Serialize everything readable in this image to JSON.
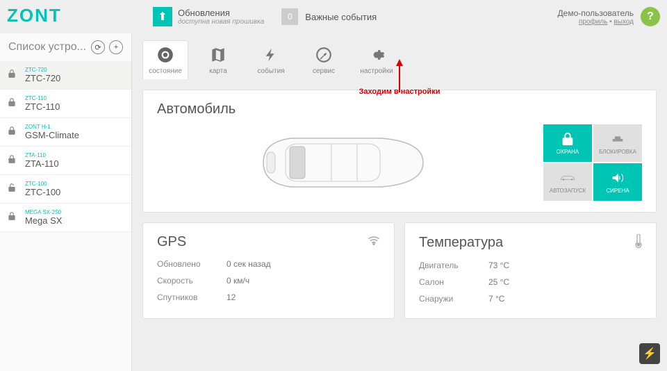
{
  "header": {
    "logo": "ZONT",
    "update_title": "Обновления",
    "update_sub": "доступна новая прошивка",
    "events_count": "0",
    "events_label": "Важные события",
    "user_name": "Демо-пользователь",
    "profile_link": "профиль",
    "logout_link": "выход"
  },
  "sidebar": {
    "title": "Список устро...",
    "devices": [
      {
        "model": "ZTC-720",
        "name": "ZTC-720",
        "locked": true
      },
      {
        "model": "ZTC-110",
        "name": "ZTC-110",
        "locked": true
      },
      {
        "model": "ZONT H-1",
        "name": "GSM-Climate",
        "locked": true
      },
      {
        "model": "ZTA-110",
        "name": "ZTA-110",
        "locked": true
      },
      {
        "model": "ZTC-100",
        "name": "ZTC-100",
        "locked": false
      },
      {
        "model": "MEGA SX-250",
        "name": "Mega SX",
        "locked": true
      }
    ]
  },
  "tabs": {
    "state": "состояние",
    "map": "карта",
    "events": "события",
    "service": "сервис",
    "settings": "настройки"
  },
  "auto_panel": {
    "title": "Автомобиль",
    "note": "Заходим в настройки",
    "controls": {
      "guard": "ОХРАНА",
      "block": "БЛОКИРОВКА",
      "autostart": "АВТОЗАПУСК",
      "siren": "СИРЕНА"
    }
  },
  "gps_panel": {
    "title": "GPS",
    "rows": [
      {
        "k": "Обновлено",
        "v": "0 сек назад"
      },
      {
        "k": "Скорость",
        "v": "0 км/ч"
      },
      {
        "k": "Спутников",
        "v": "12"
      }
    ]
  },
  "temp_panel": {
    "title": "Температура",
    "rows": [
      {
        "k": "Двигатель",
        "v": "73 °C"
      },
      {
        "k": "Салон",
        "v": "25 °C"
      },
      {
        "k": "Снаружи",
        "v": "7 °C"
      }
    ]
  }
}
